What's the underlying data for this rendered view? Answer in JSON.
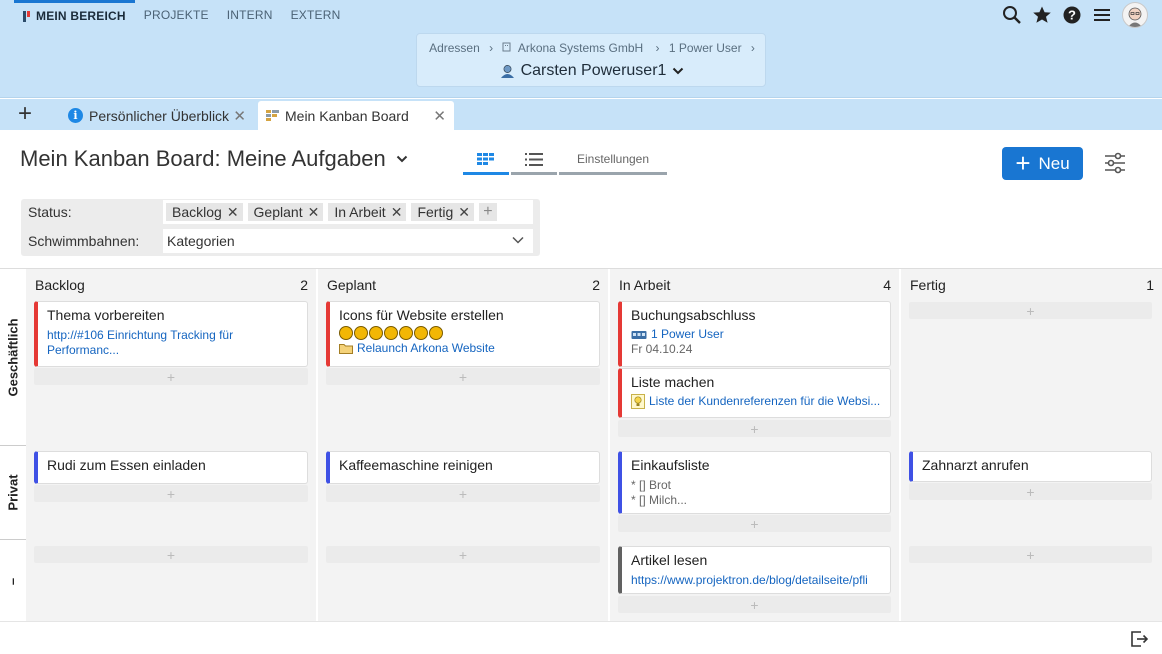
{
  "topnav": {
    "items": [
      {
        "label": "MEIN BEREICH",
        "active": true
      },
      {
        "label": "PROJEKTE"
      },
      {
        "label": "INTERN"
      },
      {
        "label": "EXTERN"
      }
    ]
  },
  "breadcrumb": {
    "items": [
      "Adressen",
      "Arkona Systems GmbH",
      "1 Power User"
    ],
    "separator": "›",
    "title": "Carsten Poweruser1"
  },
  "tabs": [
    {
      "label": "Persönlicher Überblick"
    },
    {
      "label": "Mein Kanban Board",
      "active": true
    }
  ],
  "page": {
    "title": "Mein Kanban Board: Meine Aufgaben",
    "view_settings": "Einstellungen",
    "new_button": "Neu"
  },
  "filters": {
    "status_label": "Status:",
    "status_chips": [
      "Backlog",
      "Geplant",
      "In Arbeit",
      "Fertig"
    ],
    "swimlanes_label": "Schwimmbahnen:",
    "swimlanes_value": "Kategorien"
  },
  "lanes": [
    "Geschäftlich",
    "Privat",
    "–"
  ],
  "columns": [
    {
      "name": "Backlog",
      "count": "2"
    },
    {
      "name": "Geplant",
      "count": "2"
    },
    {
      "name": "In Arbeit",
      "count": "4"
    },
    {
      "name": "Fertig",
      "count": "1"
    }
  ],
  "cards": {
    "backlog_business": {
      "title": "Thema vorbereiten",
      "link": "http://#106 Einrichtung Tracking für Performanc..."
    },
    "planned_business": {
      "title": "Icons für Website erstellen",
      "stars": 7,
      "project": "Relaunch Arkona Website"
    },
    "inwork_business_1": {
      "title": "Buchungsabschluss",
      "user": "1 Power User",
      "date": "Fr 04.10.24"
    },
    "inwork_business_2": {
      "title": "Liste machen",
      "link": "Liste der Kundenreferenzen für die Websi..."
    },
    "backlog_private": {
      "title": "Rudi zum Essen einladen"
    },
    "planned_private": {
      "title": "Kaffeemaschine reinigen"
    },
    "inwork_private": {
      "title": "Einkaufsliste",
      "line1": "* [] Brot",
      "line2": "* [] Milch..."
    },
    "done_private": {
      "title": "Zahnarzt anrufen"
    },
    "inwork_none": {
      "title": "Artikel lesen",
      "link": "https://www.projektron.de/blog/detailseite/pfli"
    }
  },
  "add_slot_symbol": "+",
  "colors": {
    "topbar": "#c6e2f8",
    "accent": "#1976d2",
    "card_red": "#e53935",
    "card_blue": "#3f51e5",
    "card_gray": "#616161"
  },
  "icons": {
    "topbar": [
      "search-icon",
      "star-icon",
      "help-icon",
      "menu-icon",
      "avatar"
    ],
    "page": [
      "chevron-down-icon",
      "board-view-icon",
      "list-view-icon",
      "filter-settings-icon",
      "exit-icon"
    ]
  }
}
